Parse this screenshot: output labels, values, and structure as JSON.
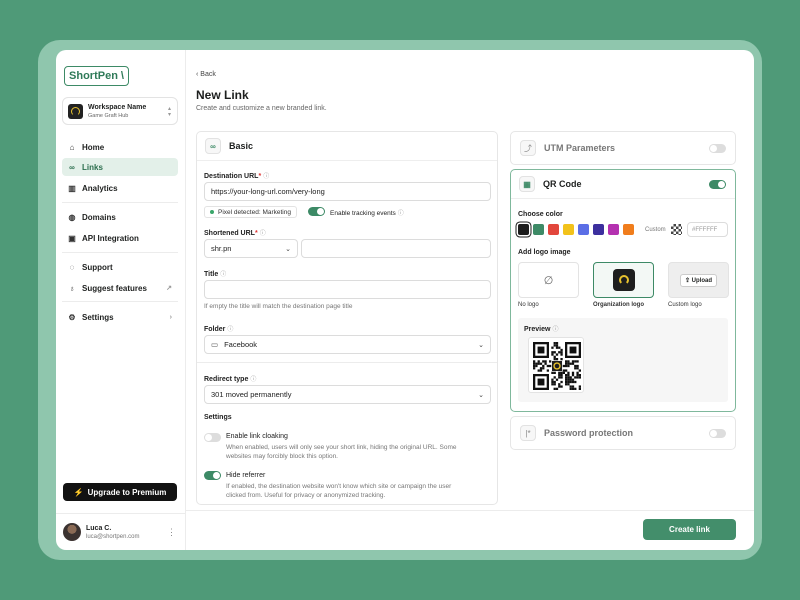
{
  "sidebar": {
    "logo": "ShortPen",
    "workspace_name": "Workspace Name",
    "workspace_sub": "Game Graft Hub",
    "items": [
      {
        "label": "Home"
      },
      {
        "label": "Links"
      },
      {
        "label": "Analytics"
      },
      {
        "label": "Domains"
      },
      {
        "label": "API Integration"
      },
      {
        "label": "Support"
      },
      {
        "label": "Suggest features"
      },
      {
        "label": "Settings"
      }
    ],
    "upgrade_label": "Upgrade to Premium",
    "user_name": "Luca C.",
    "user_email": "luca@shortpen.com"
  },
  "header": {
    "back_label": "Back",
    "title": "New Link",
    "subtitle": "Create and customize a new branded link."
  },
  "basic": {
    "title": "Basic",
    "destination_label": "Destination URL",
    "destination_value": "https://your-long-url.com/very-long",
    "pixel_text": "Pixel detected: Marketing",
    "tracking_label": "Enable tracking events",
    "tracking_on": true,
    "shortened_label": "Shortened URL",
    "domain_value": "shr.pn",
    "slug_value": "",
    "title_label": "Title",
    "title_value": "",
    "title_help": "If empty the title will match the destination page title",
    "folder_label": "Folder",
    "folder_value": "Facebook",
    "redirect_label": "Redirect type",
    "redirect_value": "301 moved permanently",
    "settings_label": "Settings",
    "cloaking_label": "Enable link cloaking",
    "cloaking_help_1": "When enabled, users will only see your short link, hiding the original URL. Some",
    "cloaking_help_2": "websites may forcibly block this option.",
    "cloaking_on": false,
    "referrer_label": "Hide referrer",
    "referrer_help_1": "If enabled, the destination website won't know which site or campaign the user",
    "referrer_help_2": "clicked from. Useful for privacy or anonymized tracking.",
    "referrer_on": true
  },
  "utm": {
    "title": "UTM Parameters",
    "on": false
  },
  "qr": {
    "title": "QR Code",
    "on": true,
    "choose_color_label": "Choose color",
    "colors": [
      "#1c1c1c",
      "#3d8a66",
      "#e2463c",
      "#f2c21b",
      "#5b6ee6",
      "#3c2f9e",
      "#b431b0",
      "#f07d1c"
    ],
    "custom_label": "Custom",
    "custom_value": "#FFFFFF",
    "add_logo_label": "Add logo image",
    "logo_options": [
      "No logo",
      "Organization logo",
      "Custom logo"
    ],
    "upload_label": "Upload",
    "preview_label": "Preview"
  },
  "password": {
    "title": "Password protection",
    "on": false
  },
  "footer": {
    "create_label": "Create link"
  }
}
